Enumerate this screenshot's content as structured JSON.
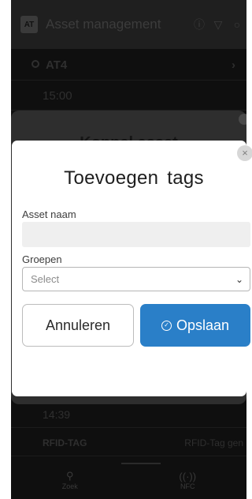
{
  "app": {
    "title": "Asset management",
    "logo_text": "AT"
  },
  "list": {
    "location_label": "AT4",
    "time_1": "15:00",
    "time_2": "14:39",
    "rfid_label": "RFID-TAG",
    "rfid_value": "RFID-Tag gen"
  },
  "background_sheet": {
    "title": "Koppel asset"
  },
  "modal": {
    "title": "Toevoegen tags",
    "asset_name_label": "Asset naam",
    "asset_name_value": "",
    "groups_label": "Groepen",
    "groups_placeholder": "Select",
    "cancel_label": "Annuleren",
    "save_label": "Opslaan"
  },
  "bottom_nav": {
    "item_1": "Zoek",
    "item_2": "NFC"
  },
  "colors": {
    "accent": "#2a7fc8",
    "overlay": "#0f0f0f"
  }
}
